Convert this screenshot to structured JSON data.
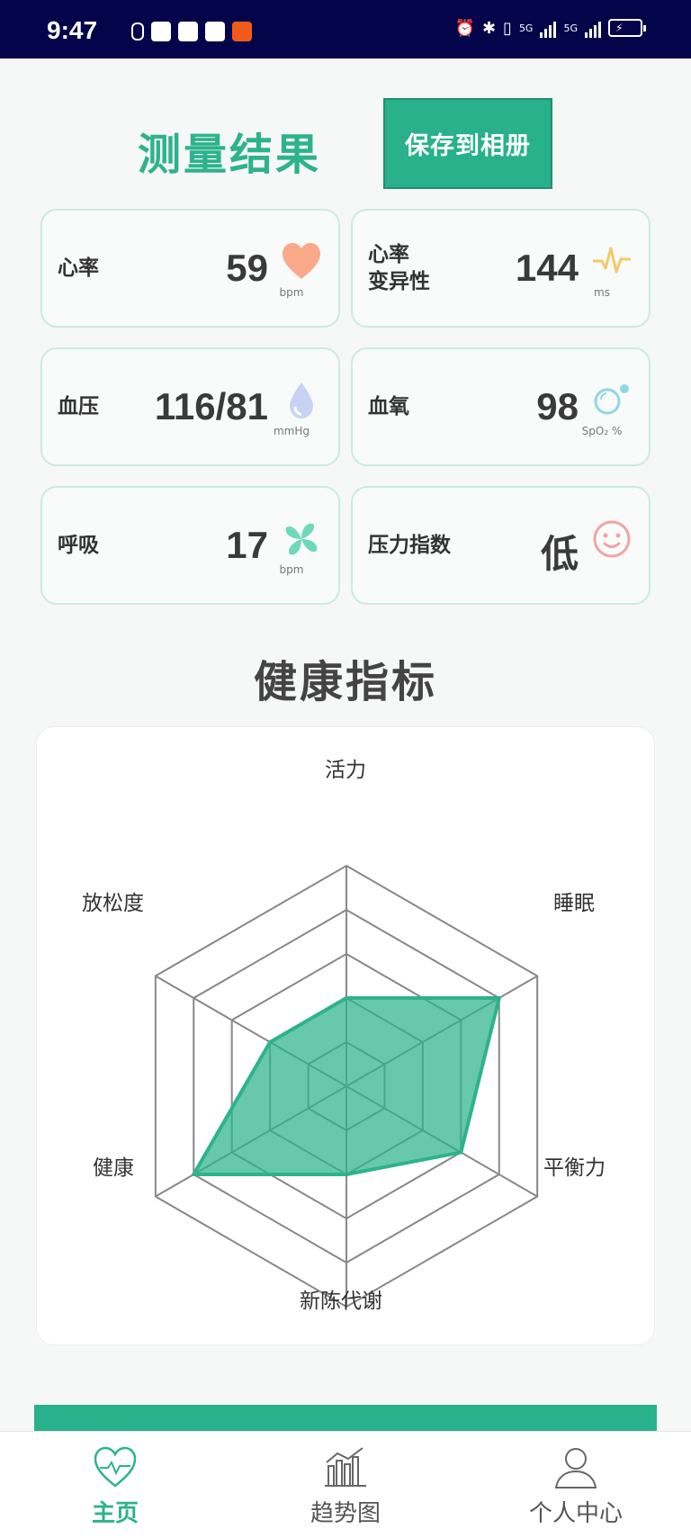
{
  "status_bar": {
    "time": "9:47",
    "network_label_1": "5G",
    "network_label_2": "5G"
  },
  "header": {
    "title": "测量结果",
    "save_button": "保存到相册"
  },
  "metrics": {
    "heart_rate": {
      "label": "心率",
      "value": "59",
      "unit": "bpm",
      "icon": "heart-icon",
      "color": "#f9a88a"
    },
    "hrv": {
      "label_line1": "心率",
      "label_line2": "变异性",
      "value": "144",
      "unit": "ms",
      "icon": "pulse-wave-icon",
      "color": "#f5c86a"
    },
    "blood_pressure": {
      "label": "血压",
      "value": "116/81",
      "unit": "mmHg",
      "icon": "water-drop-icon",
      "color": "#b9c8f0"
    },
    "blood_oxygen": {
      "label": "血氧",
      "value": "98",
      "unit": "SpO₂ %",
      "icon": "oxygen-bubble-icon",
      "color": "#8fd7e6"
    },
    "respiration": {
      "label": "呼吸",
      "value": "17",
      "unit": "bpm",
      "icon": "fan-icon",
      "color": "#6ed9b9"
    },
    "stress": {
      "label": "压力指数",
      "value": "低",
      "icon": "smiley-icon",
      "color": "#f3a3a3"
    }
  },
  "health_section": {
    "title": "健康指标"
  },
  "chart_data": {
    "type": "radar",
    "axes": [
      "活力",
      "睡眠",
      "平衡力",
      "新陈代谢",
      "健康",
      "放松度"
    ],
    "values": [
      2,
      4,
      3,
      2,
      4,
      2
    ],
    "max": 5,
    "levels": 5,
    "fill_color": "#2db38c"
  },
  "bottom_nav": {
    "items": [
      {
        "label": "主页",
        "icon": "heart-monitor-icon",
        "active": true
      },
      {
        "label": "趋势图",
        "icon": "trend-chart-icon",
        "active": false
      },
      {
        "label": "个人中心",
        "icon": "user-icon",
        "active": false
      }
    ]
  }
}
